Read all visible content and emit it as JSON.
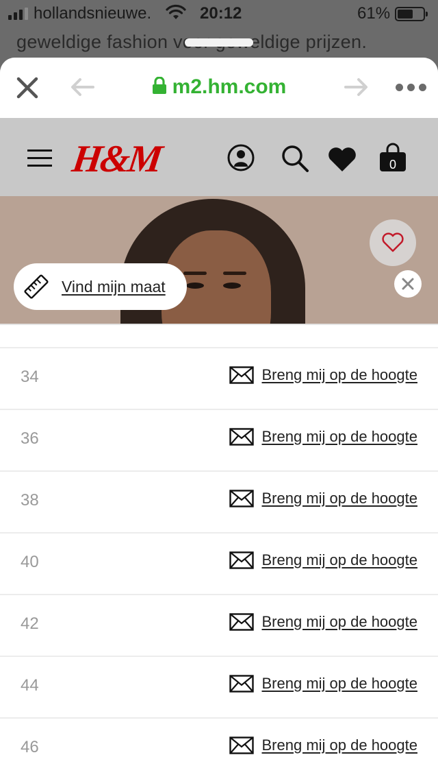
{
  "status_bar": {
    "carrier": "hollandsnieuwe.",
    "time": "20:12",
    "battery_percent": "61%",
    "battery_level": 0.61
  },
  "background_page": {
    "text": "geweldige fashion voor geweldige prijzen."
  },
  "browser": {
    "url": "m2.hm.com",
    "icons": [
      "close-icon",
      "back-arrow-icon",
      "lock-icon",
      "forward-arrow-icon",
      "more-icon"
    ]
  },
  "hm_header": {
    "logo_text": "H&M",
    "cart_count": "0",
    "colors": {
      "logo": "#cc0000",
      "header_bg": "#c8c8c8"
    },
    "icons": [
      "menu-icon",
      "account-icon",
      "search-icon",
      "favorites-heart-icon",
      "cart-bag-icon"
    ]
  },
  "hero": {
    "size_finder_label": "Vind mijn maat",
    "icons": [
      "wishlist-heart-icon",
      "dismiss-icon",
      "ruler-icon"
    ]
  },
  "size_list": {
    "notify_label": "Breng mij op de hoogte",
    "rows": [
      {
        "size": "34"
      },
      {
        "size": "36"
      },
      {
        "size": "38"
      },
      {
        "size": "40"
      },
      {
        "size": "42"
      },
      {
        "size": "44"
      },
      {
        "size": "46"
      }
    ]
  },
  "colors": {
    "url_green": "#34b233",
    "size_text": "#999999"
  }
}
